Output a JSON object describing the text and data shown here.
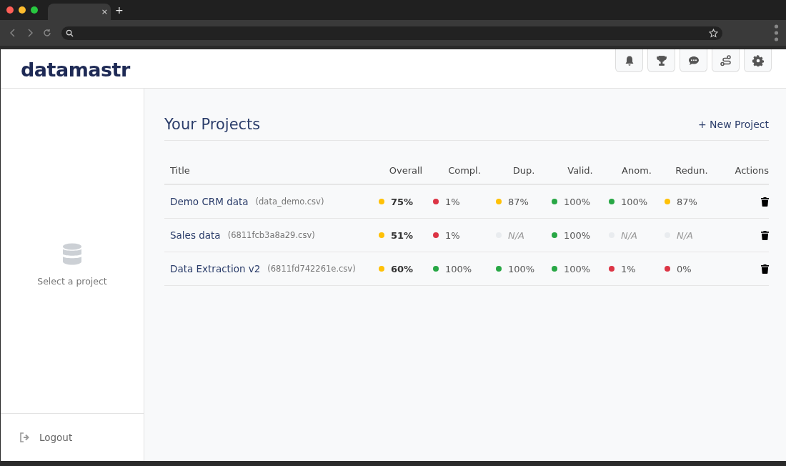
{
  "browser": {
    "tab_close": "×",
    "new_tab": "+"
  },
  "header": {
    "logo": "datamastr"
  },
  "sidebar": {
    "empty_text": "Select a project",
    "logout": "Logout"
  },
  "main": {
    "title": "Your Projects",
    "new_project": "+ New Project"
  },
  "table": {
    "columns": [
      "Title",
      "Overall",
      "Compl.",
      "Dup.",
      "Valid.",
      "Anom.",
      "Redun.",
      "Actions"
    ],
    "rows": [
      {
        "title": "Demo CRM data",
        "file": "(data_demo.csv)",
        "overall": {
          "value": "75%",
          "color": "#ffc107"
        },
        "metrics": [
          {
            "kind": "score",
            "value": "1%",
            "color": "#dc3545"
          },
          {
            "kind": "score",
            "value": "87%",
            "color": "#ffc107"
          },
          {
            "kind": "score",
            "value": "100%",
            "color": "#28a745"
          },
          {
            "kind": "score",
            "value": "100%",
            "color": "#28a745"
          },
          {
            "kind": "score",
            "value": "87%",
            "color": "#ffc107"
          }
        ]
      },
      {
        "title": "Sales data",
        "file": "(6811fcb3a8a29.csv)",
        "overall": {
          "value": "51%",
          "color": "#ffc107"
        },
        "metrics": [
          {
            "kind": "score",
            "value": "1%",
            "color": "#dc3545"
          },
          {
            "kind": "missing",
            "value": "N/A",
            "color": "#e9ecef"
          },
          {
            "kind": "score",
            "value": "100%",
            "color": "#28a745"
          },
          {
            "kind": "missing",
            "value": "N/A",
            "color": "#e9ecef"
          },
          {
            "kind": "missing",
            "value": "N/A",
            "color": "#e9ecef"
          }
        ]
      },
      {
        "title": "Data Extraction v2",
        "file": "(6811fd742261e.csv)",
        "overall": {
          "value": "60%",
          "color": "#ffc107"
        },
        "metrics": [
          {
            "kind": "score",
            "value": "100%",
            "color": "#28a745"
          },
          {
            "kind": "score",
            "value": "100%",
            "color": "#28a745"
          },
          {
            "kind": "score",
            "value": "100%",
            "color": "#28a745"
          },
          {
            "kind": "score",
            "value": "1%",
            "color": "#dc3545"
          },
          {
            "kind": "score",
            "value": "0%",
            "color": "#dc3545"
          }
        ]
      }
    ]
  }
}
